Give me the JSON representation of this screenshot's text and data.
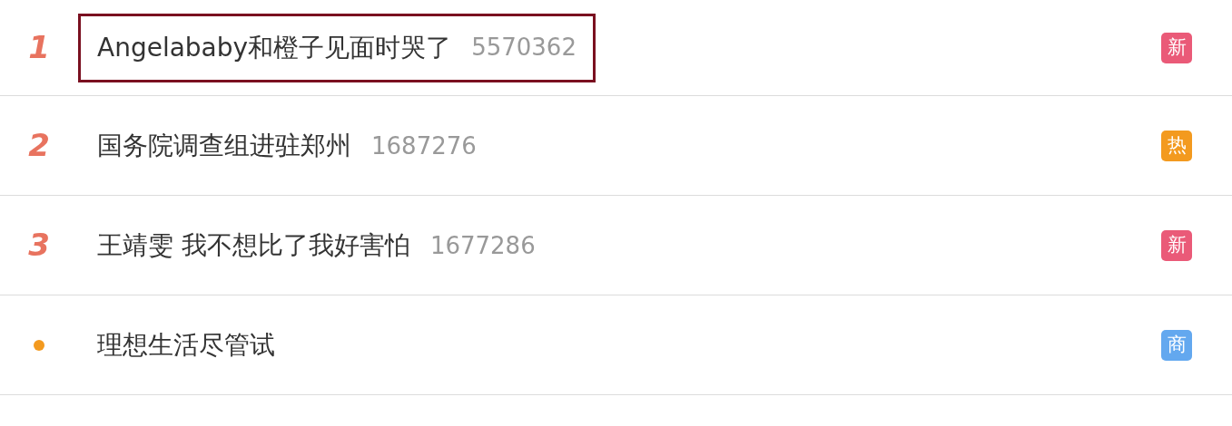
{
  "hot_list": [
    {
      "kind": "ranked",
      "rank": "1",
      "title": "Angelababy和橙子见面时哭了",
      "count": "5570362",
      "badge": "新",
      "color": "#ea5a78",
      "highlighted": true
    },
    {
      "kind": "ranked",
      "rank": "2",
      "title": "国务院调查组进驻郑州",
      "count": "1687276",
      "badge": "热",
      "color": "#f39a1f",
      "highlighted": false
    },
    {
      "kind": "ranked",
      "rank": "3",
      "title": "王靖雯 我不想比了我好害怕",
      "count": "1677286",
      "badge": "新",
      "color": "#ea5a78",
      "highlighted": false
    },
    {
      "kind": "promoted",
      "title": "理想生活尽管试",
      "badge": "商",
      "color": "#63a8ef",
      "highlighted": false
    }
  ]
}
